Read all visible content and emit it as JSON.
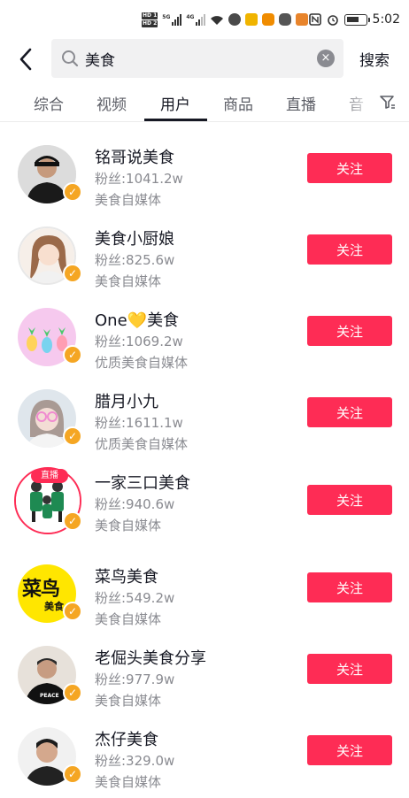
{
  "status_bar": {
    "time": "5:02",
    "hd_labels": [
      "HD 1",
      "HD 2"
    ],
    "network": [
      "5G",
      "4G"
    ]
  },
  "search": {
    "query": "美食",
    "submit_label": "搜索",
    "clear_symbol": "×"
  },
  "tabs": [
    {
      "label": "综合"
    },
    {
      "label": "视频"
    },
    {
      "label": "用户"
    },
    {
      "label": "商品"
    },
    {
      "label": "直播"
    },
    {
      "label": "音"
    }
  ],
  "active_tab": "用户",
  "users": [
    {
      "name": "铭哥说美食",
      "fans": "粉丝:1041.2w",
      "desc": "美食自媒体",
      "follow_label": "关注",
      "verified": true
    },
    {
      "name": "美食小厨娘",
      "fans": "粉丝:825.6w",
      "desc": "美食自媒体",
      "follow_label": "关注",
      "verified": true
    },
    {
      "name": "One💛美食",
      "fans": "粉丝:1069.2w",
      "desc": "优质美食自媒体",
      "follow_label": "关注",
      "verified": true
    },
    {
      "name": "腊月小九",
      "fans": "粉丝:1611.1w",
      "desc": "优质美食自媒体",
      "follow_label": "关注",
      "verified": true
    },
    {
      "name": "一家三口美食",
      "fans": "粉丝:940.6w",
      "desc": "美食自媒体",
      "follow_label": "关注",
      "verified": true,
      "live_label": "直播"
    },
    {
      "name": "菜鸟美食",
      "fans": "粉丝:549.2w",
      "desc": "美食自媒体",
      "follow_label": "关注",
      "verified": true,
      "avatar_text": "菜鸟",
      "avatar_subtext": "美食"
    },
    {
      "name": "老倔头美食分享",
      "fans": "粉丝:977.9w",
      "desc": "美食自媒体",
      "follow_label": "关注",
      "verified": true,
      "shirt_text": "PEACE"
    },
    {
      "name": "杰仔美食",
      "fans": "粉丝:329.0w",
      "desc": "美食自媒体",
      "follow_label": "关注",
      "verified": true
    }
  ],
  "colors": {
    "accent": "#fe2c55",
    "verify_badge": "#f5a623",
    "search_bg": "#f1f1f2",
    "secondary_text": "#8a8b91"
  }
}
